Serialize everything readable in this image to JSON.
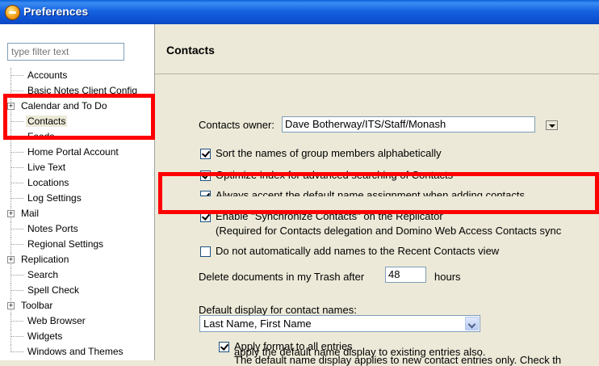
{
  "window": {
    "title": "Preferences"
  },
  "sidebar": {
    "filter_placeholder": "type filter text",
    "items": [
      {
        "label": "Accounts",
        "expandable": false
      },
      {
        "label": "Basic Notes Client Config",
        "expandable": false
      },
      {
        "label": "Calendar and To Do",
        "expandable": true
      },
      {
        "label": "Contacts",
        "expandable": false,
        "selected": true
      },
      {
        "label": "Feeds",
        "expandable": false
      },
      {
        "label": "Home Portal Account",
        "expandable": false
      },
      {
        "label": "Live Text",
        "expandable": false
      },
      {
        "label": "Locations",
        "expandable": false
      },
      {
        "label": "Log Settings",
        "expandable": false
      },
      {
        "label": "Mail",
        "expandable": true
      },
      {
        "label": "Notes Ports",
        "expandable": false
      },
      {
        "label": "Regional Settings",
        "expandable": false
      },
      {
        "label": "Replication",
        "expandable": true
      },
      {
        "label": "Search",
        "expandable": false
      },
      {
        "label": "Spell Check",
        "expandable": false
      },
      {
        "label": "Toolbar",
        "expandable": true
      },
      {
        "label": "Web Browser",
        "expandable": false
      },
      {
        "label": "Widgets",
        "expandable": false
      },
      {
        "label": "Windows and Themes",
        "expandable": false
      }
    ],
    "expander_symbol": "+"
  },
  "main": {
    "title": "Contacts",
    "owner": {
      "label": "Contacts owner:",
      "value": "Dave Botherway/ITS/Staff/Monash"
    },
    "options": [
      {
        "label": "Sort the names of group members alphabetically",
        "checked": true
      },
      {
        "label": "Optimize index for advanced searching of Contacts",
        "checked": true
      },
      {
        "label": "Always accept the default name assignment when adding contacts",
        "checked": true
      },
      {
        "label": "Enable \"Synchronize Contacts\" on the Replicator",
        "checked": true
      },
      {
        "label": "Do not automatically add names to the Recent Contacts view",
        "checked": false
      }
    ],
    "sync_note": "(Required for Contacts delegation and Domino Web Access Contacts sync",
    "trash": {
      "prefix": "Delete documents in my Trash after",
      "value": "48",
      "suffix": "hours"
    },
    "display": {
      "label": "Default display for contact names:",
      "selected": "Last Name, First Name",
      "apply_all": {
        "label": "Apply format to all entries",
        "checked": true
      },
      "help_line1": "The default name display applies to new contact entries only.  Check th",
      "help_line2": "apply the default name display to existing entries also."
    }
  },
  "colors": {
    "titlebar": "#0A5FD7",
    "annotation": "#FF0000",
    "panel": "#ECE9D8"
  }
}
